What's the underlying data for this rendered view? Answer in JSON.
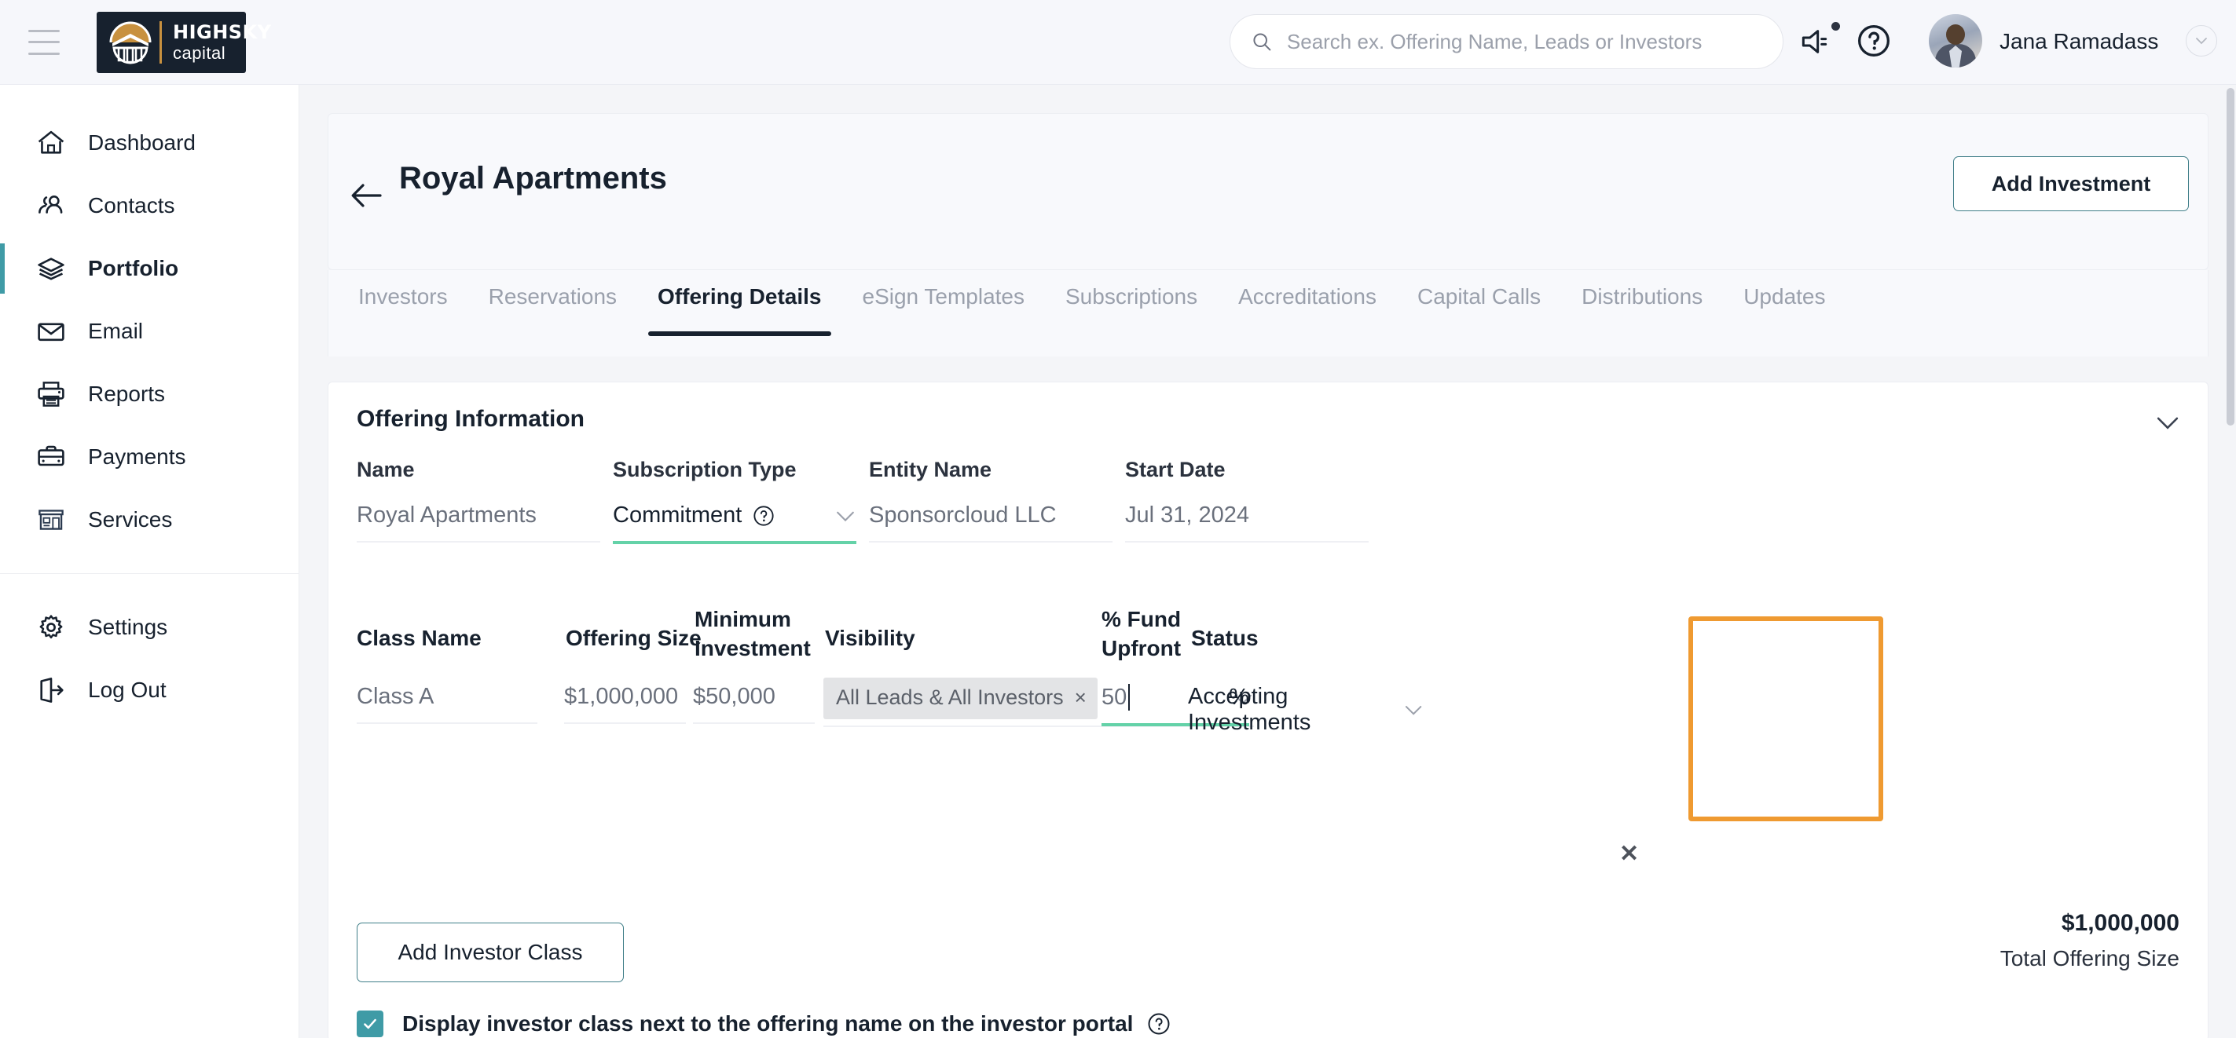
{
  "header": {
    "menu_icon": "hamburger-icon",
    "logo": {
      "line1": "HIGHSKY",
      "line2": "capital"
    },
    "search": {
      "placeholder": "Search ex. Offering Name, Leads or Investors",
      "value": ""
    },
    "announcement_icon": "megaphone-icon",
    "help_icon": "help-circle-icon",
    "user_name": "Jana Ramadass",
    "user_chevron_icon": "chevron-down-icon"
  },
  "sidebar": {
    "items": [
      {
        "label": "Dashboard",
        "icon": "home-icon",
        "active": false
      },
      {
        "label": "Contacts",
        "icon": "users-icon",
        "active": false
      },
      {
        "label": "Portfolio",
        "icon": "layers-icon",
        "active": true
      },
      {
        "label": "Email",
        "icon": "envelope-icon",
        "active": false
      },
      {
        "label": "Reports",
        "icon": "printer-icon",
        "active": false
      },
      {
        "label": "Payments",
        "icon": "briefcase-icon",
        "active": false
      },
      {
        "label": "Services",
        "icon": "storefront-icon",
        "active": false
      }
    ],
    "footer_items": [
      {
        "label": "Settings",
        "icon": "gear-icon"
      },
      {
        "label": "Log Out",
        "icon": "logout-icon"
      }
    ]
  },
  "page": {
    "back_icon": "arrow-left-icon",
    "title": "Royal Apartments",
    "add_investment_label": "Add Investment"
  },
  "tabs": [
    {
      "label": "Investors",
      "active": false
    },
    {
      "label": "Reservations",
      "active": false
    },
    {
      "label": "Offering Details",
      "active": true
    },
    {
      "label": "eSign Templates",
      "active": false
    },
    {
      "label": "Subscriptions",
      "active": false
    },
    {
      "label": "Accreditations",
      "active": false
    },
    {
      "label": "Capital Calls",
      "active": false
    },
    {
      "label": "Distributions",
      "active": false
    },
    {
      "label": "Updates",
      "active": false
    }
  ],
  "offering_information": {
    "section_title": "Offering Information",
    "collapse_icon": "chevron-down-icon",
    "fields": [
      {
        "label": "Name",
        "value": "Royal Apartments",
        "type": "text",
        "focused": false
      },
      {
        "label": "Subscription Type",
        "value": "Commitment",
        "type": "select",
        "focused": true,
        "help_icon": "help-circle-icon"
      },
      {
        "label": "Entity Name",
        "value": "Sponsorcloud LLC",
        "type": "text",
        "focused": false
      },
      {
        "label": "Start Date",
        "value": "Jul 31, 2024",
        "type": "date",
        "focused": false
      }
    ],
    "class_table": {
      "columns": [
        "Class Name",
        "Offering Size",
        "Minimum Investment",
        "Visibility",
        "% Fund Upfront",
        "Status"
      ],
      "row": {
        "class_name": "Class A",
        "offering_size": "$1,000,000",
        "minimum_investment": "$50,000",
        "visibility_chip": "All Leads & All Investors",
        "visibility_chip_remove": "×",
        "visibility_clear_all": "✕",
        "visibility_chevron": "chevron-down-icon",
        "fund_upfront_value": "50",
        "fund_upfront_suffix": "%",
        "status": "Accepting Investments",
        "status_chevron": "chevron-down-icon"
      }
    },
    "add_investor_class_label": "Add Investor Class",
    "total_offering_amount": "$1,000,000",
    "total_offering_label": "Total Offering Size",
    "display_class_checkbox": {
      "checked": true,
      "label": "Display investor class next to the offering name on the investor portal",
      "help_icon": "help-circle-icon"
    }
  },
  "colors": {
    "accent_teal": "#3f9ba6",
    "focus_green": "#64d2a8",
    "highlight_orange": "#ef9a31",
    "logo_gold": "#c8913f",
    "logo_navy": "#17212e",
    "page_bg": "#f4f5f8"
  }
}
